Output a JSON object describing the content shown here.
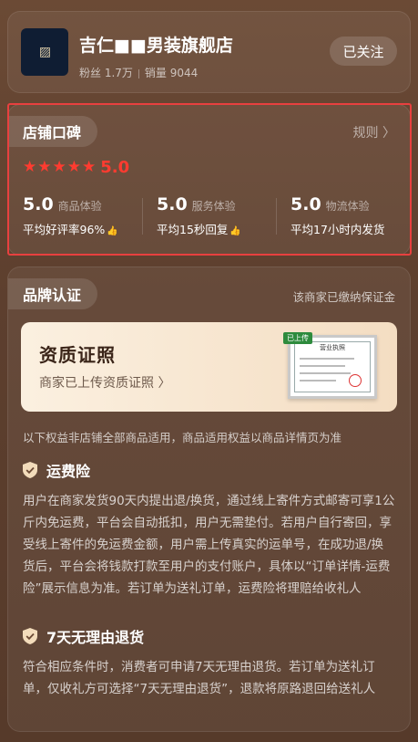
{
  "shop": {
    "name": "吉仁■■男装旗舰店",
    "followers_label": "粉丝 1.7万",
    "sales_label": "销量 9044",
    "follow_button": "已关注"
  },
  "reputation": {
    "title": "店铺口碑",
    "rules_link": "规则 〉",
    "stars": 5,
    "score": "5.0",
    "metrics": [
      {
        "value": "5.0",
        "name": "商品体验",
        "desc": "平均好评率96%"
      },
      {
        "value": "5.0",
        "name": "服务体验",
        "desc": "平均15秒回复"
      },
      {
        "value": "5.0",
        "name": "物流体验",
        "desc": "平均17小时内发货"
      }
    ]
  },
  "brand": {
    "title": "品牌认证",
    "deposit_note": "该商家已缴纳保证金",
    "cert_title": "资质证照",
    "cert_sub": "商家已上传资质证照 〉",
    "cert_tag": "已上传",
    "cert_doc_title": "营业执照",
    "scope_note": "以下权益非店铺全部商品适用，商品适用权益以商品详情页为准"
  },
  "guarantees": [
    {
      "title": "运费险",
      "body": "用户在商家发货90天内提出退/换货，通过线上寄件方式邮寄可享1公斤内免运费，平台会自动抵扣，用户无需垫付。若用户自行寄回，享受线上寄件的免运费金额，用户需上传真实的运单号，在成功退/换货后，平台会将钱款打款至用户的支付账户，具体以“订单详情-运费险”展示信息为准。若订单为送礼订单，运费险将理赔给收礼人"
    },
    {
      "title": "7天无理由退货",
      "body": "符合相应条件时，消费者可申请7天无理由退货。若订单为送礼订单，仅收礼方可选择“7天无理由退货”，退款将原路退回给送礼人"
    }
  ],
  "colors": {
    "accent_red": "#ff3b30",
    "highlight_border": "#e8403f"
  }
}
